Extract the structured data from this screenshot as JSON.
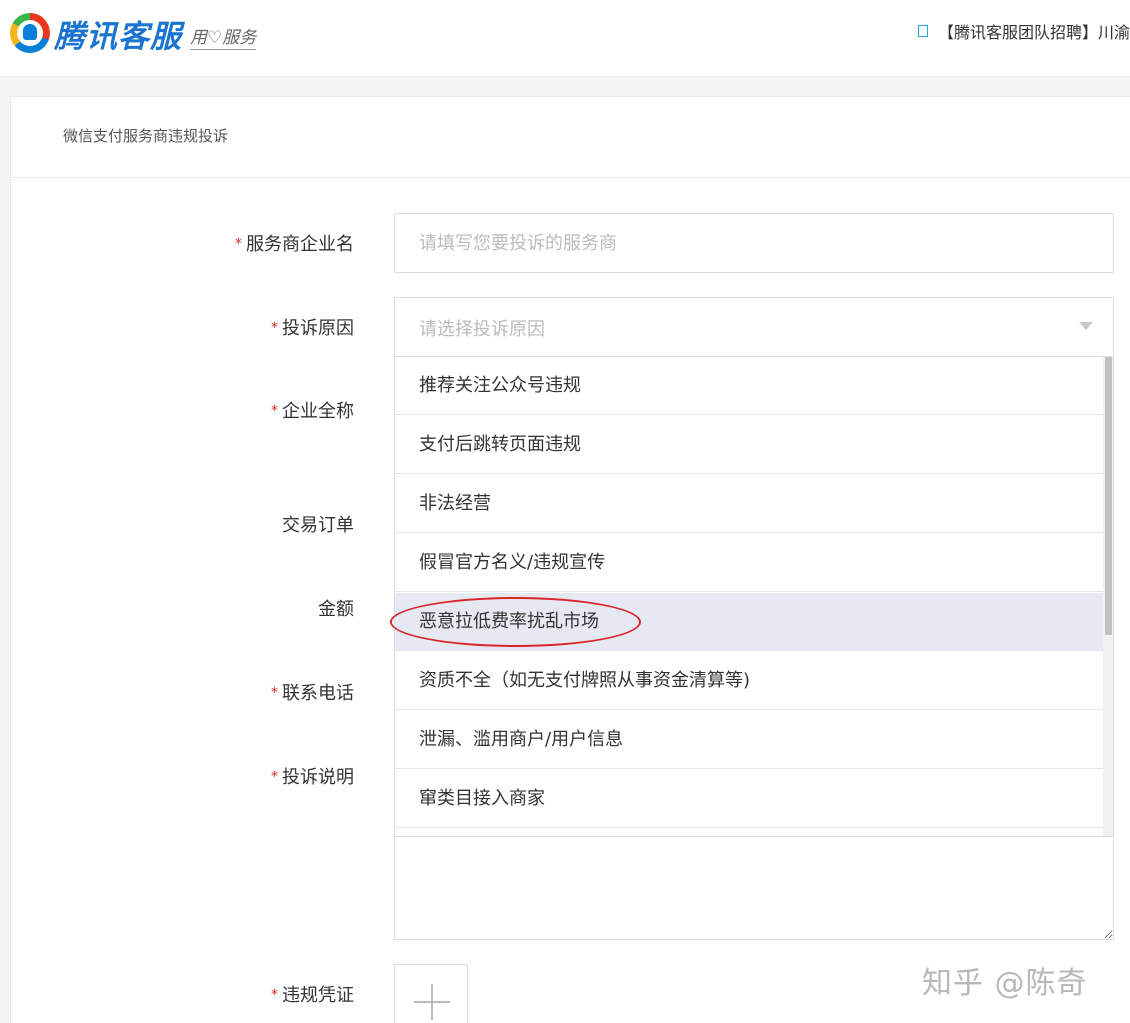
{
  "header": {
    "logo_text": "腾讯客服",
    "logo_slogan": "用♡服务",
    "notice_text": "【腾讯客服团队招聘】川渝"
  },
  "card": {
    "title": "微信支付服务商违规投诉"
  },
  "form": {
    "required_mark": "*",
    "provider_name": {
      "label": "服务商企业名",
      "placeholder": "请填写您要投诉的服务商"
    },
    "reason": {
      "label": "投诉原因",
      "placeholder": "请选择投诉原因",
      "options": [
        "推荐关注公众号违规",
        "支付后跳转页面违规",
        "非法经营",
        "假冒官方名义/违规宣传",
        "恶意拉低费率扰乱市场",
        "资质不全（如无支付牌照从事资金清算等)",
        "泄漏、滥用商户/用户信息",
        "窜类目接入商家"
      ],
      "highlighted_option": "恶意拉低费率扰乱市场"
    },
    "company_full_name": {
      "label": "企业全称"
    },
    "transaction_order": {
      "label": "交易订单"
    },
    "amount": {
      "label": "金额"
    },
    "contact_phone": {
      "label": "联系电话"
    },
    "description": {
      "label": "投诉说明"
    },
    "evidence": {
      "label": "违规凭证"
    }
  },
  "watermark": "知乎 @陈奇",
  "colors": {
    "accent_blue": "#1b75d0",
    "required_red": "#d9262a",
    "highlight_bg": "#e6e9f1",
    "annotation_red": "#d9262a"
  },
  "icons": {
    "logo": "tencent-penguin-logo-icon",
    "notice": "notice-square-icon",
    "select_arrow": "caret-down-icon",
    "upload": "plus-icon"
  }
}
